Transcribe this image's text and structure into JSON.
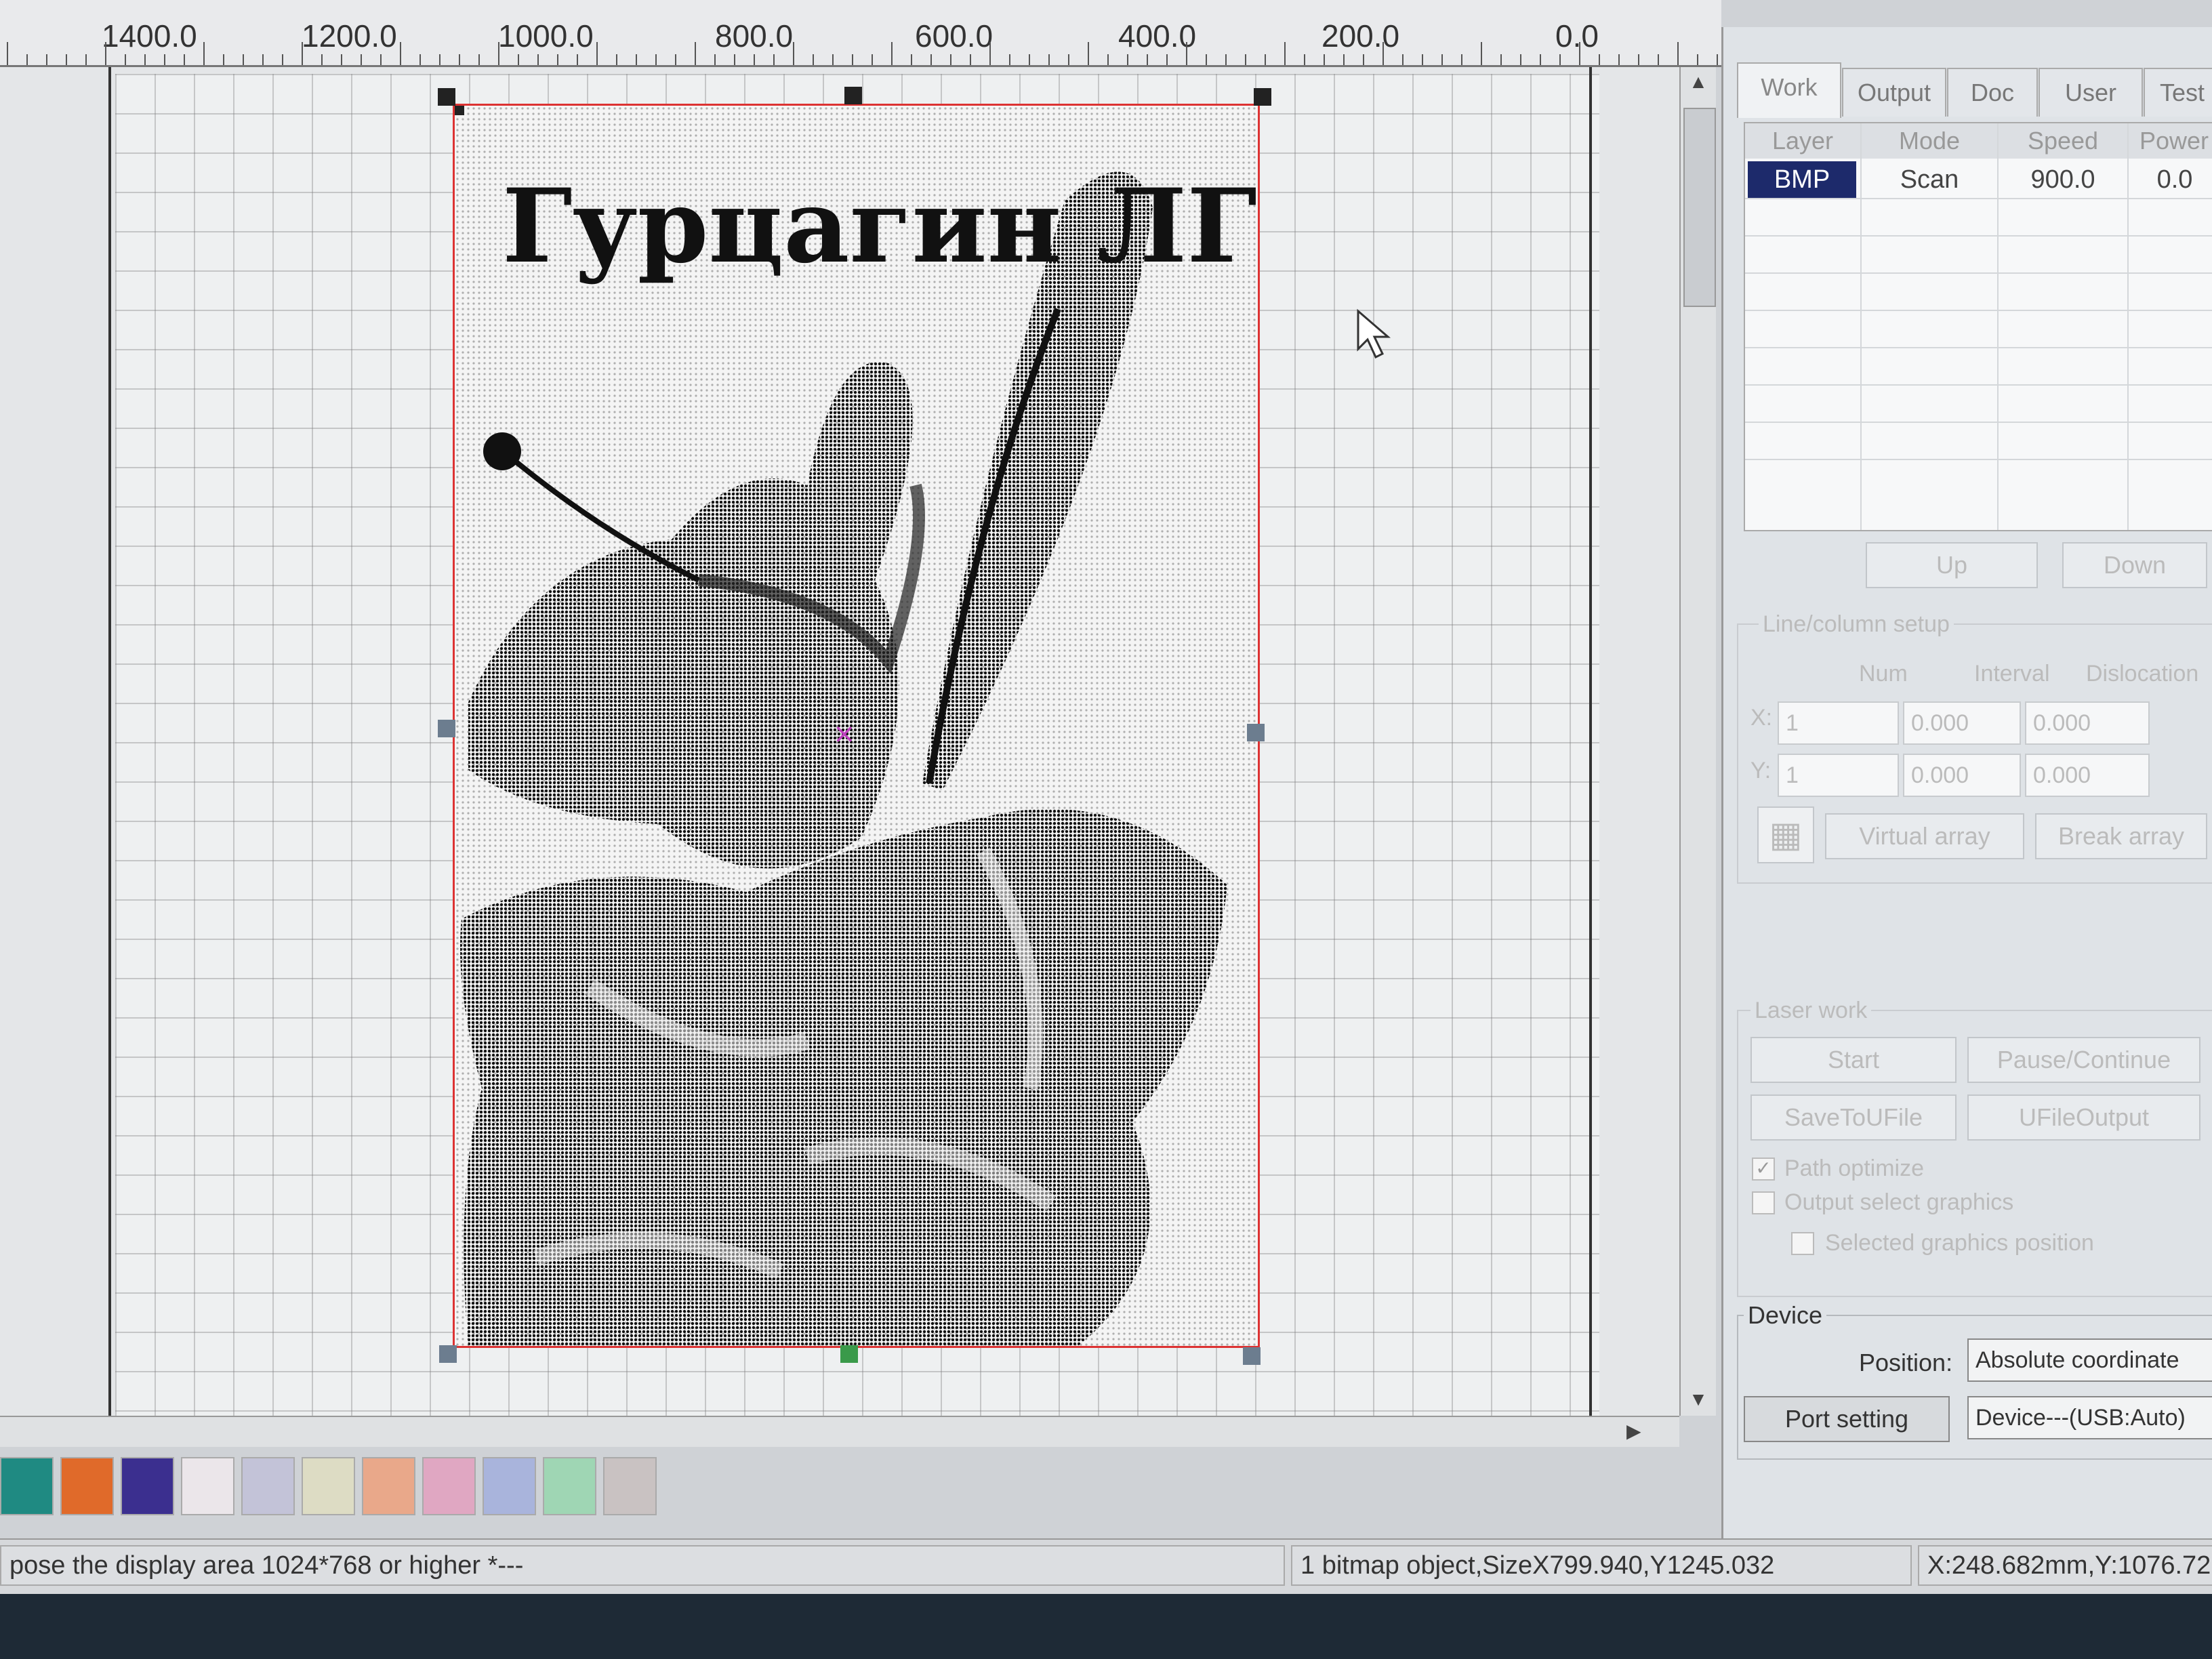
{
  "ruler": {
    "labels": [
      "1400.0",
      "1200.0",
      "1000.0",
      "800.0",
      "600.0",
      "400.0",
      "200.0",
      "0.0"
    ]
  },
  "bitmap": {
    "title_text": "Гурцагин ЛГ"
  },
  "palette": {
    "colors": [
      "#1f8a82",
      "#e06a2a",
      "#3b2f8f",
      "#ebe6ea",
      "#c3c3d8",
      "#dddcc4",
      "#e9a88a",
      "#e0a7c2",
      "#a9b4dc",
      "#9fd6b4",
      "#c9c2c2"
    ]
  },
  "status": {
    "hint": "pose the display area 1024*768 or higher *---",
    "selection": "1 bitmap object,SizeX799.940,Y1245.032",
    "coords": "X:248.682mm,Y:1076.72"
  },
  "panel": {
    "tabs": [
      "Work",
      "Output",
      "Doc",
      "User",
      "Test"
    ],
    "table_headers": [
      "Layer",
      "Mode",
      "Speed",
      "Power"
    ],
    "rows": [
      {
        "layer": "BMP",
        "mode": "Scan",
        "speed": "900.0",
        "power": "0.0"
      }
    ],
    "up_button": "Up",
    "down_button": "Down",
    "line_column": {
      "title": "Line/column setup",
      "col_num": "Num",
      "col_interval": "Interval",
      "col_dislocation": "Dislocation",
      "x_label": "X:",
      "y_label": "Y:",
      "x_num": "1",
      "x_interval": "0.000",
      "x_dislocation": "0.000",
      "y_num": "1",
      "y_interval": "0.000",
      "y_dislocation": "0.000",
      "virtual_array": "Virtual array",
      "break_array": "Break array"
    },
    "laser_work": {
      "title": "Laser work",
      "start": "Start",
      "pause": "Pause/Continue",
      "save_ufile": "SaveToUFile",
      "ufile_output": "UFileOutput",
      "path_optimize": "Path optimize",
      "output_select": "Output select graphics",
      "selected_position": "Selected graphics position"
    },
    "device": {
      "title": "Device",
      "position_label": "Position:",
      "position_value": "Absolute coordinate",
      "port_setting": "Port setting",
      "device_value": "Device---(USB:Auto)"
    }
  }
}
